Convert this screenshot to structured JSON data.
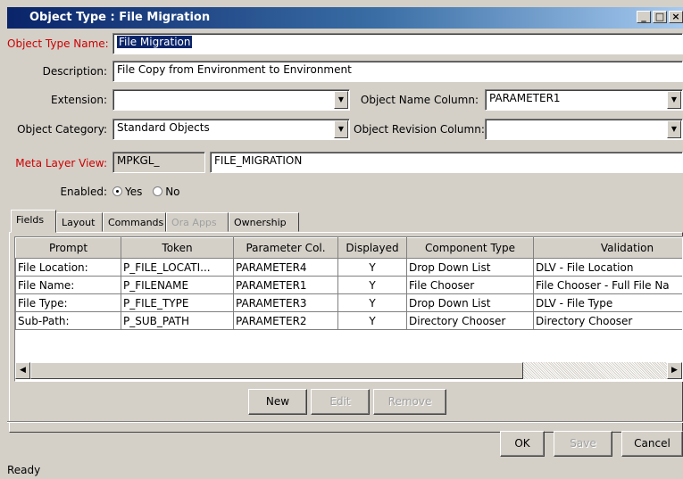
{
  "window": {
    "title": "Object Type : File Migration"
  },
  "form": {
    "object_type_name_label": "Object Type Name:",
    "object_type_name_value": "File Migration",
    "description_label": "Description:",
    "description_value": "File Copy from Environment to Environment",
    "extension_label": "Extension:",
    "extension_value": "",
    "object_name_column_label": "Object Name Column:",
    "object_name_column_value": "PARAMETER1",
    "object_category_label": "Object Category:",
    "object_category_value": "Standard Objects",
    "object_revision_column_label": "Object Revision Column:",
    "object_revision_column_value": "",
    "meta_layer_view_label": "Meta Layer View:",
    "meta_layer_prefix": "MPKGL_",
    "meta_layer_value": "FILE_MIGRATION",
    "enabled_label": "Enabled:",
    "enabled_yes": "Yes",
    "enabled_no": "No",
    "enabled_selected": "Yes"
  },
  "tabs": [
    "Fields",
    "Layout",
    "Commands",
    "Ora Apps",
    "Ownership"
  ],
  "table": {
    "headers": [
      "Prompt",
      "Token",
      "Parameter Col.",
      "Displayed",
      "Component Type",
      "Validation"
    ],
    "rows": [
      [
        "File Location:",
        "P_FILE_LOCATI...",
        "PARAMETER4",
        "Y",
        "Drop Down List",
        "DLV - File Location"
      ],
      [
        "File Name:",
        "P_FILENAME",
        "PARAMETER1",
        "Y",
        "File Chooser",
        "File Chooser - Full File Na"
      ],
      [
        "File Type:",
        "P_FILE_TYPE",
        "PARAMETER3",
        "Y",
        "Drop Down List",
        "DLV - File Type"
      ],
      [
        "Sub-Path:",
        "P_SUB_PATH",
        "PARAMETER2",
        "Y",
        "Directory Chooser",
        "Directory Chooser"
      ]
    ]
  },
  "table_buttons": {
    "new": "New",
    "edit": "Edit",
    "remove": "Remove"
  },
  "dialog_buttons": {
    "ok": "OK",
    "save": "Save",
    "cancel": "Cancel"
  },
  "status": "Ready"
}
